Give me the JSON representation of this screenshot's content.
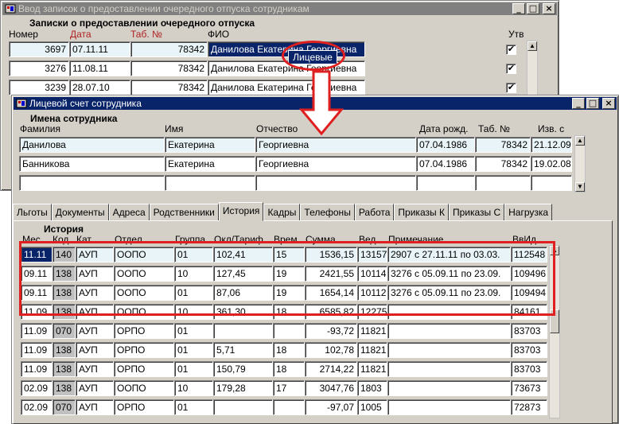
{
  "win1": {
    "title": "Ввод записок о предоставлении очередного отпуска сотрудникам",
    "section_title": "Записки о предоставлении очередного отпуска",
    "headers": {
      "num": "Номер",
      "date": "Дата",
      "tab": "Таб. №",
      "fio": "ФИО",
      "utv": "Утв"
    },
    "rows": [
      {
        "num": "3697",
        "date": "07.11.11",
        "tab": "78342",
        "fio": "Данилова Екатерина Георгиевна",
        "checked": "✔"
      },
      {
        "num": "3276",
        "date": "11.08.11",
        "tab": "78342",
        "fio": "Данилова Екатерина Георгиевна",
        "checked": "✔"
      },
      {
        "num": "3239",
        "date": "28.07.10",
        "tab": "78342",
        "fio": "Данилова Екатерина Георгиевна",
        "checked": "✔"
      }
    ]
  },
  "tooltip_button": "Лицевые",
  "win2": {
    "title": "Лицевой счет сотрудника",
    "section_title": "Имена сотрудника",
    "headers": {
      "fam": "Фамилия",
      "name": "Имя",
      "otch": "Отчество",
      "birth": "Дата рожд.",
      "tab": "Таб. №",
      "izv": "Изв. с"
    },
    "rows": [
      {
        "fam": "Данилова",
        "name": "Екатерина",
        "otch": "Георгиевна",
        "birth": "07.04.1986",
        "tab": "78342",
        "izv": "21.12.09"
      },
      {
        "fam": "Банникова",
        "name": "Екатерина",
        "otch": "Георгиевна",
        "birth": "07.04.1986",
        "tab": "78342",
        "izv": "19.02.08"
      },
      {
        "fam": "",
        "name": "",
        "otch": "",
        "birth": "",
        "tab": "",
        "izv": ""
      }
    ],
    "tabs": [
      "Льготы",
      "Документы",
      "Адреса",
      "Родственники",
      "История",
      "Кадры",
      "Телефоны",
      "Работа",
      "Приказы К",
      "Приказы С",
      "Нагрузка"
    ],
    "active_tab": "История",
    "history": {
      "title": "История",
      "headers": {
        "mes": "Мес.",
        "kod": "Код",
        "kat": "Кат.",
        "otdel": "Отдел",
        "gruppa": "Группа",
        "okl": "Окл/Тариф",
        "vrem": "Врем.",
        "summa": "Сумма",
        "ved": "Вед.",
        "prim": "Примечание",
        "vvid": "ВвИд"
      },
      "rows": [
        {
          "mes": "11.11",
          "kod": "140",
          "kat": "АУП",
          "otdel": "ООПО",
          "gruppa": "01",
          "okl": "102,41",
          "vrem": "15",
          "summa": "1536,15",
          "ved": "13157",
          "prim": "2907 с 27.11.11 по 03.03.",
          "vvid": "112548"
        },
        {
          "mes": "09.11",
          "kod": "138",
          "kat": "АУП",
          "otdel": "ООПО",
          "gruppa": "10",
          "okl": "127,45",
          "vrem": "19",
          "summa": "2421,55",
          "ved": "10114",
          "prim": "3276 с 05.09.11 по 23.09.",
          "vvid": "109496"
        },
        {
          "mes": "09.11",
          "kod": "138",
          "kat": "АУП",
          "otdel": "ООПО",
          "gruppa": "01",
          "okl": "87,06",
          "vrem": "19",
          "summa": "1654,14",
          "ved": "10112",
          "prim": "3276 с 05.09.11 по 23.09.",
          "vvid": "109494"
        },
        {
          "mes": "11.09",
          "kod": "138",
          "kat": "АУП",
          "otdel": "ООПО",
          "gruppa": "10",
          "okl": "361,30",
          "vrem": "18",
          "summa": "6585,82",
          "ved": "12275",
          "prim": "",
          "vvid": "84161"
        },
        {
          "mes": "11.09",
          "kod": "070",
          "kat": "АУП",
          "otdel": "ОРПО",
          "gruppa": "01",
          "okl": "",
          "vrem": "",
          "summa": "-93,72",
          "ved": "11821",
          "prim": "",
          "vvid": "83703"
        },
        {
          "mes": "11.09",
          "kod": "138",
          "kat": "АУП",
          "otdel": "ОРПО",
          "gruppa": "01",
          "okl": "5,71",
          "vrem": "18",
          "summa": "102,78",
          "ved": "11821",
          "prim": "",
          "vvid": "83703"
        },
        {
          "mes": "11.09",
          "kod": "138",
          "kat": "АУП",
          "otdel": "ОРПО",
          "gruppa": "01",
          "okl": "150,79",
          "vrem": "18",
          "summa": "2714,22",
          "ved": "11821",
          "prim": "",
          "vvid": "83703"
        },
        {
          "mes": "02.09",
          "kod": "138",
          "kat": "АУП",
          "otdel": "ООПО",
          "gruppa": "10",
          "okl": "179,28",
          "vrem": "17",
          "summa": "3047,76",
          "ved": "1803",
          "prim": "",
          "vvid": "73673"
        },
        {
          "mes": "02.09",
          "kod": "070",
          "kat": "АУП",
          "otdel": "ОРПО",
          "gruppa": "01",
          "okl": "",
          "vrem": "",
          "summa": "-97,07",
          "ved": "1005",
          "prim": "",
          "vvid": "72873"
        }
      ]
    }
  },
  "colors": {
    "title_active": "#0a246a",
    "title_inactive": "#808080",
    "window_bg": "#d4d0c8",
    "annotation": "#e02020",
    "row_highlight": "#e8f4f8"
  },
  "icons": {
    "app": "app-icon",
    "minimize": "minimize-icon",
    "maximize": "maximize-icon",
    "close": "close-icon",
    "arrow": "down-arrow-icon"
  }
}
